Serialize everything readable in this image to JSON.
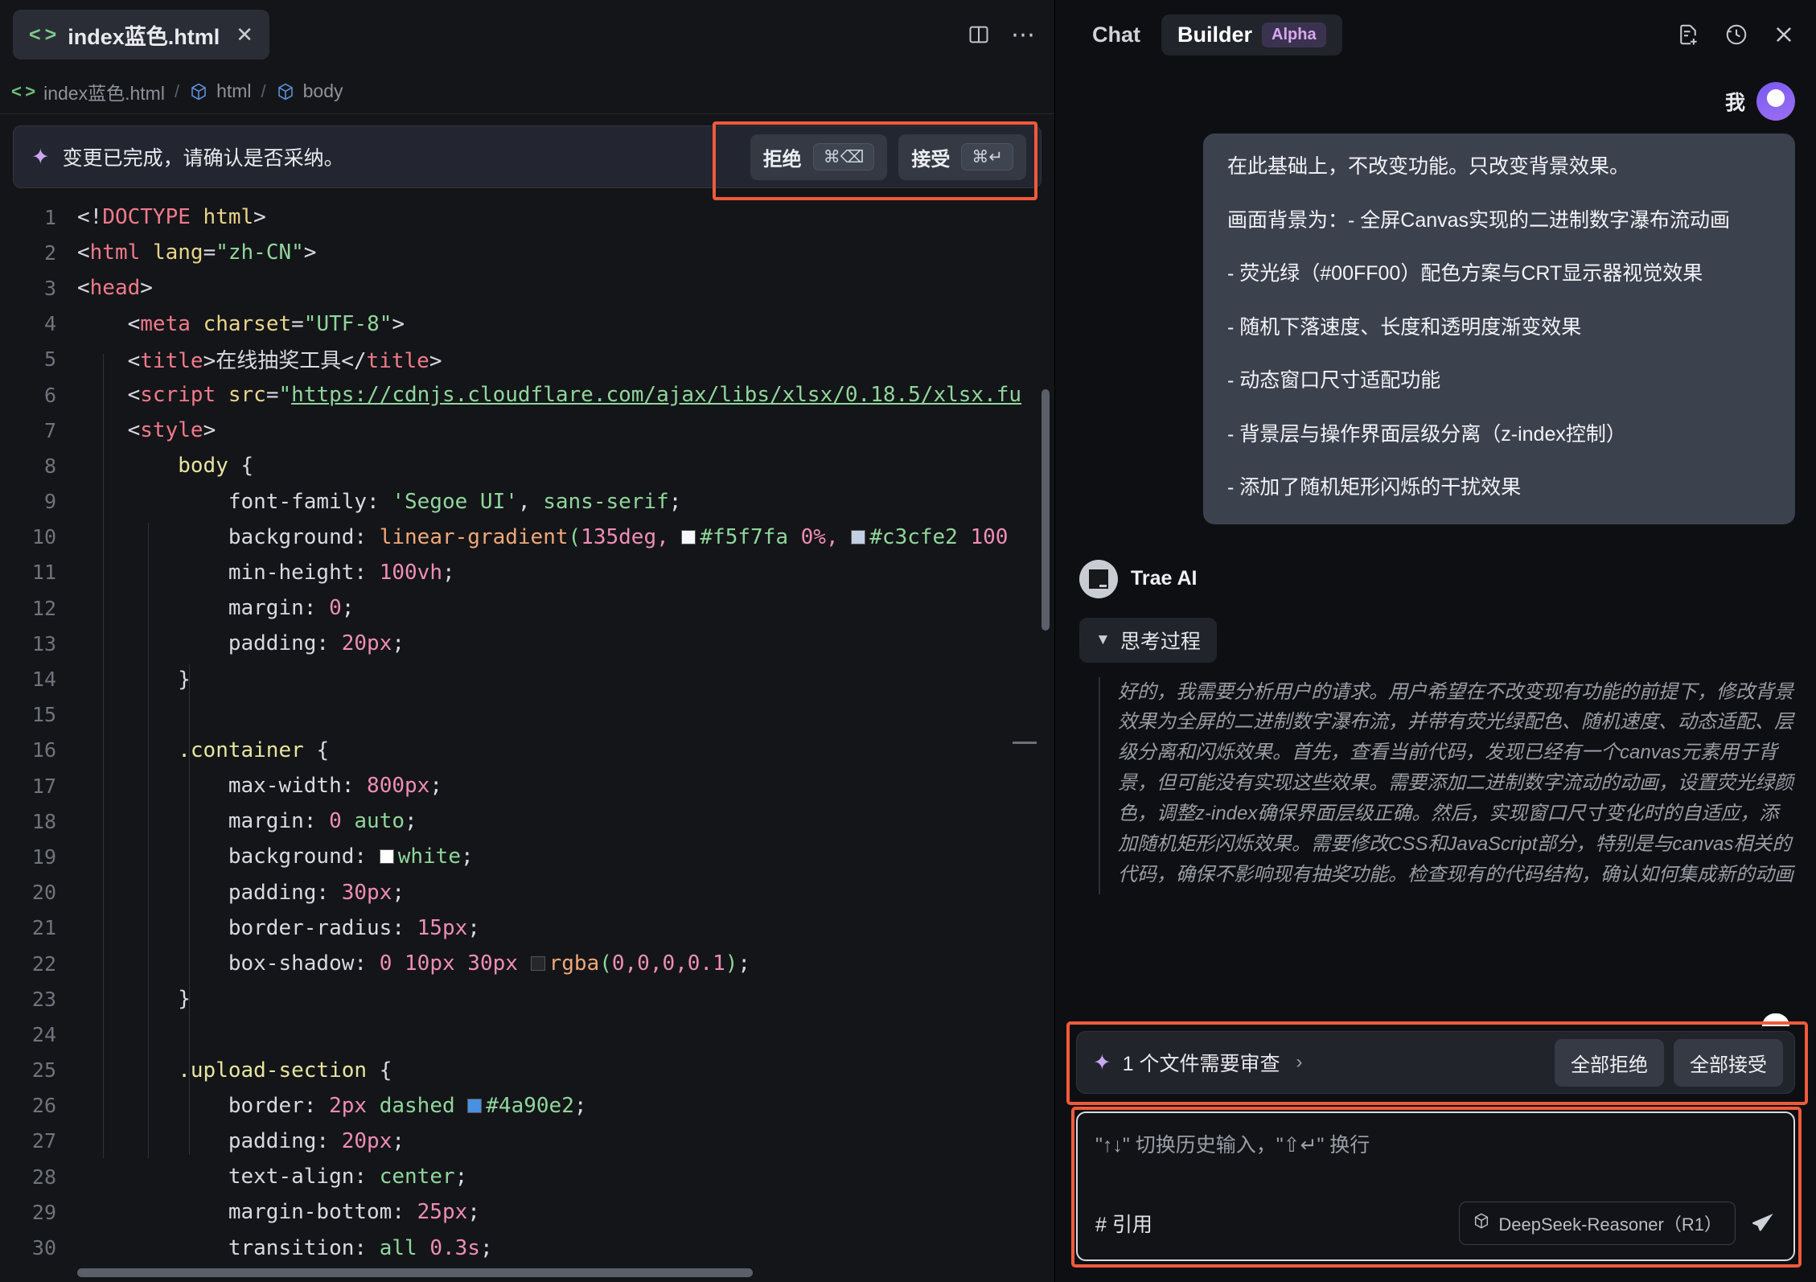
{
  "editor": {
    "tab": {
      "filename": "index蓝色.html",
      "code_icon": "code-brackets-icon",
      "close": "✕"
    },
    "tab_actions": {
      "split_editor": "split-editor-icon",
      "more": "⋯"
    },
    "breadcrumb": {
      "file": "index蓝色.html",
      "sep": "/",
      "node1": "html",
      "node2": "body"
    },
    "banner": {
      "icon": "sparkle-icon",
      "message": "变更已完成，请确认是否采纳。",
      "reject_label": "拒绝",
      "reject_shortcut": "⌘⌫",
      "accept_label": "接受",
      "accept_shortcut": "⌘↵"
    },
    "code_lines": [
      {
        "n": "1",
        "html": "<span class=\"t-punc\">&lt;!</span><span class=\"t-tag\">DOCTYPE</span> <span class=\"t-attr\">html</span><span class=\"t-punc\">&gt;</span>"
      },
      {
        "n": "2",
        "html": "<span class=\"t-punc\">&lt;</span><span class=\"t-tag\">html</span> <span class=\"t-attr\">lang</span><span class=\"t-punc\">=</span><span class=\"t-str\">\"zh-CN\"</span><span class=\"t-punc\">&gt;</span>"
      },
      {
        "n": "3",
        "html": "<span class=\"t-punc\">&lt;</span><span class=\"t-tag\">head</span><span class=\"t-punc\">&gt;</span>"
      },
      {
        "n": "4",
        "html": "    <span class=\"t-punc\">&lt;</span><span class=\"t-tag\">meta</span> <span class=\"t-attr\">charset</span><span class=\"t-punc\">=</span><span class=\"t-str\">\"UTF-8\"</span><span class=\"t-punc\">&gt;</span>"
      },
      {
        "n": "5",
        "html": "    <span class=\"t-punc\">&lt;</span><span class=\"t-tag\">title</span><span class=\"t-punc\">&gt;</span><span class=\"t-prop\">在线抽奖工具</span><span class=\"t-punc\">&lt;/</span><span class=\"t-tag\">title</span><span class=\"t-punc\">&gt;</span>"
      },
      {
        "n": "6",
        "html": "    <span class=\"t-punc\">&lt;</span><span class=\"t-tag\">script</span> <span class=\"t-attr\">src</span><span class=\"t-punc\">=</span><span class=\"t-str\">\"</span><span class=\"t-link\">https://cdnjs.cloudflare.com/ajax/libs/xlsx/0.18.5/xlsx.fu</span>"
      },
      {
        "n": "7",
        "html": "    <span class=\"t-punc\">&lt;</span><span class=\"t-tag\">style</span><span class=\"t-punc\">&gt;</span>"
      },
      {
        "n": "8",
        "html": "        <span class=\"t-sel\">body</span> <span class=\"t-punc\">{</span>"
      },
      {
        "n": "9",
        "html": "            <span class=\"t-prop\">font-family</span><span class=\"t-punc\">:</span> <span class=\"t-str\">'Segoe UI'</span><span class=\"t-punc\">,</span> <span class=\"t-str\">sans-serif</span><span class=\"t-punc\">;</span>"
      },
      {
        "n": "10",
        "html": "            <span class=\"t-prop\">background</span><span class=\"t-punc\">:</span> <span class=\"t-fn\">linear-gradient</span><span class=\"t-kw\">(</span><span class=\"t-num\">135deg</span><span class=\"t-num\">,</span> <span class=\"swatch\" style=\"background:#f5f7fa\"></span><span class=\"t-str\">#f5f7fa</span> <span class=\"t-num\">0%</span><span class=\"t-num\">,</span> <span class=\"swatch\" style=\"background:#c3cfe2\"></span><span class=\"t-str\">#c3cfe2</span> <span class=\"t-num\">100</span>"
      },
      {
        "n": "11",
        "html": "            <span class=\"t-prop\">min-height</span><span class=\"t-punc\">:</span> <span class=\"t-num\">100vh</span><span class=\"t-punc\">;</span>"
      },
      {
        "n": "12",
        "html": "            <span class=\"t-prop\">margin</span><span class=\"t-punc\">:</span> <span class=\"t-num\">0</span><span class=\"t-punc\">;</span>"
      },
      {
        "n": "13",
        "html": "            <span class=\"t-prop\">padding</span><span class=\"t-punc\">:</span> <span class=\"t-num\">20px</span><span class=\"t-punc\">;</span>"
      },
      {
        "n": "14",
        "html": "        <span class=\"t-punc\">}</span>"
      },
      {
        "n": "15",
        "html": ""
      },
      {
        "n": "16",
        "html": "        <span class=\"t-sel\">.container</span> <span class=\"t-punc\">{</span>"
      },
      {
        "n": "17",
        "html": "            <span class=\"t-prop\">max-width</span><span class=\"t-punc\">:</span> <span class=\"t-num\">800px</span><span class=\"t-punc\">;</span>"
      },
      {
        "n": "18",
        "html": "            <span class=\"t-prop\">margin</span><span class=\"t-punc\">:</span> <span class=\"t-num\">0</span> <span class=\"t-str\">auto</span><span class=\"t-punc\">;</span>"
      },
      {
        "n": "19",
        "html": "            <span class=\"t-prop\">background</span><span class=\"t-punc\">:</span> <span class=\"swatch\" style=\"background:#ffffff\"></span><span class=\"t-str\">white</span><span class=\"t-punc\">;</span>"
      },
      {
        "n": "20",
        "html": "            <span class=\"t-prop\">padding</span><span class=\"t-punc\">:</span> <span class=\"t-num\">30px</span><span class=\"t-punc\">;</span>"
      },
      {
        "n": "21",
        "html": "            <span class=\"t-prop\">border-radius</span><span class=\"t-punc\">:</span> <span class=\"t-num\">15px</span><span class=\"t-punc\">;</span>"
      },
      {
        "n": "22",
        "html": "            <span class=\"t-prop\">box-shadow</span><span class=\"t-punc\">:</span> <span class=\"t-num\">0</span> <span class=\"t-num\">10px</span> <span class=\"t-num\">30px</span> <span class=\"swatch\" style=\"background:rgba(255,255,255,0.08)\"></span><span class=\"t-fn\">rgba</span><span class=\"t-kw\">(</span><span class=\"t-num\">0,0,0,0.1</span><span class=\"t-kw\">)</span><span class=\"t-punc\">;</span>"
      },
      {
        "n": "23",
        "html": "        <span class=\"t-punc\">}</span>"
      },
      {
        "n": "24",
        "html": ""
      },
      {
        "n": "25",
        "html": "        <span class=\"t-sel\">.upload-section</span> <span class=\"t-punc\">{</span>"
      },
      {
        "n": "26",
        "html": "            <span class=\"t-prop\">border</span><span class=\"t-punc\">:</span> <span class=\"t-num\">2px</span> <span class=\"t-str\">dashed</span> <span class=\"swatch\" style=\"background:#4a90e2\"></span><span class=\"t-str\">#4a90e2</span><span class=\"t-punc\">;</span>"
      },
      {
        "n": "27",
        "html": "            <span class=\"t-prop\">padding</span><span class=\"t-punc\">:</span> <span class=\"t-num\">20px</span><span class=\"t-punc\">;</span>"
      },
      {
        "n": "28",
        "html": "            <span class=\"t-prop\">text-align</span><span class=\"t-punc\">:</span> <span class=\"t-str\">center</span><span class=\"t-punc\">;</span>"
      },
      {
        "n": "29",
        "html": "            <span class=\"t-prop\">margin-bottom</span><span class=\"t-punc\">:</span> <span class=\"t-num\">25px</span><span class=\"t-punc\">;</span>"
      },
      {
        "n": "30",
        "html": "            <span class=\"t-prop\">transition</span><span class=\"t-punc\">:</span> <span class=\"t-str\">all</span> <span class=\"t-num\">0.3s</span><span class=\"t-punc\">;</span>"
      }
    ]
  },
  "chat": {
    "tabs": [
      {
        "label": "Chat",
        "active": false,
        "badge": null
      },
      {
        "label": "Builder",
        "active": true,
        "badge": "Alpha"
      }
    ],
    "header_icons": [
      "new-chat-icon",
      "history-icon",
      "close-icon"
    ],
    "user": {
      "name": "我",
      "avatar": "user-avatar"
    },
    "user_message": [
      "在此基础上，不改变功能。只改变背景效果。",
      "画面背景为：- 全屏Canvas实现的二进制数字瀑布流动画",
      "- 荧光绿（#00FF00）配色方案与CRT显示器视觉效果",
      "- 随机下落速度、长度和透明度渐变效果",
      "- 动态窗口尺寸适配功能",
      "- 背景层与操作界面层级分离（z-index控制）",
      "- 添加了随机矩形闪烁的干扰效果"
    ],
    "assistant": {
      "name": "Trae AI",
      "thinking_label": "思考过程",
      "thinking_text": "好的，我需要分析用户的请求。用户希望在不改变现有功能的前提下，修改背景效果为全屏的二进制数字瀑布流，并带有荧光绿配色、随机速度、动态适配、层级分离和闪烁效果。首先，查看当前代码，发现已经有一个canvas元素用于背景，但可能没有实现这些效果。需要添加二进制数字流动的动画，设置荧光绿颜色，调整z-index确保界面层级正确。然后，实现窗口尺寸变化时的自适应，添加随机矩形闪烁效果。需要修改CSS和JavaScript部分，特别是与canvas相关的代码，确保不影响现有抽奖功能。检查现有的代码结构，确认如何集成新的动画逻辑，同时保持代码的清晰和"
    },
    "review": {
      "icon": "sparkle-icon",
      "text": "1 个文件需要审查",
      "chevron": "›",
      "reject_all": "全部拒绝",
      "accept_all": "全部接受"
    },
    "composer": {
      "placeholder": "\"↑↓\" 切换历史输入，\"⇧↵\" 换行",
      "quote_label": "# 引用",
      "model": "DeepSeek-Reasoner（R1）",
      "send": "send-icon"
    }
  },
  "colors": {
    "accent_red_highlight": "#f05a3c",
    "alpha_badge": "#d9a7ef",
    "sparkle": "#c9a6f0"
  }
}
